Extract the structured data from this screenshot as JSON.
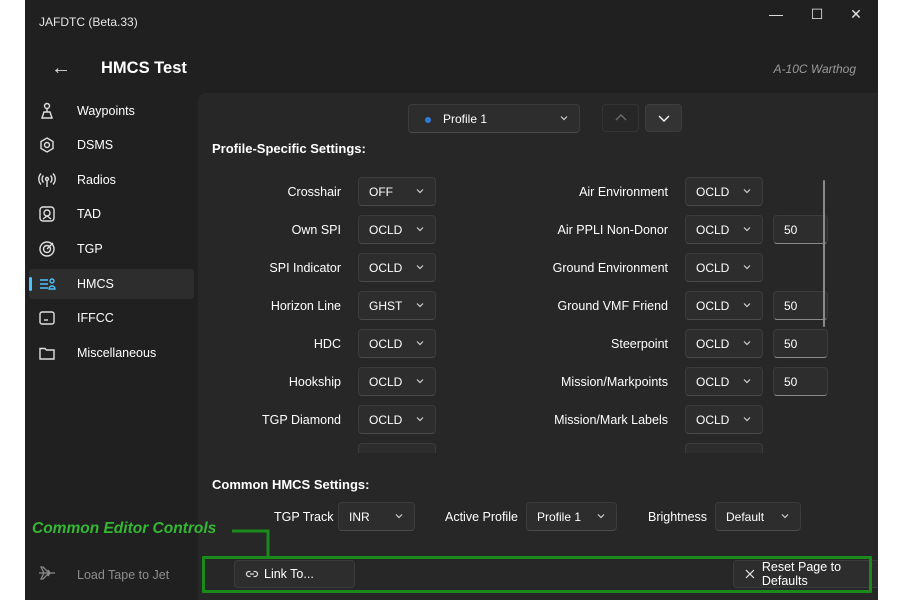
{
  "window": {
    "title": "JAFDTC (Beta.33)",
    "minimize_glyph": "—",
    "maximize_glyph": "☐",
    "close_glyph": "✕"
  },
  "header": {
    "back_glyph": "←",
    "title": "HMCS Test",
    "aircraft": "A-10C Warthog"
  },
  "sidebar": {
    "items": [
      {
        "label": "Waypoints",
        "icon": "waypoints-icon"
      },
      {
        "label": "DSMS",
        "icon": "dsms-icon"
      },
      {
        "label": "Radios",
        "icon": "radio-icon"
      },
      {
        "label": "TAD",
        "icon": "tad-icon"
      },
      {
        "label": "TGP",
        "icon": "tgp-icon"
      },
      {
        "label": "HMCS",
        "icon": "hmcs-icon",
        "selected": true
      },
      {
        "label": "IFFCC",
        "icon": "iffcc-icon"
      },
      {
        "label": "Miscellaneous",
        "icon": "folder-icon"
      }
    ],
    "load_tape": "Load Tape to Jet"
  },
  "profile_selector": {
    "value": "Profile 1",
    "accent": "#2e7cd6"
  },
  "profile_settings": {
    "heading": "Profile-Specific Settings:",
    "left": [
      {
        "label": "Crosshair",
        "value": "OFF"
      },
      {
        "label": "Own SPI",
        "value": "OCLD"
      },
      {
        "label": "SPI Indicator",
        "value": "OCLD"
      },
      {
        "label": "Horizon Line",
        "value": "GHST"
      },
      {
        "label": "HDC",
        "value": "OCLD"
      },
      {
        "label": "Hookship",
        "value": "OCLD"
      },
      {
        "label": "TGP Diamond",
        "value": "OCLD"
      }
    ],
    "right": [
      {
        "label": "Air Environment",
        "value": "OCLD",
        "number": ""
      },
      {
        "label": "Air PPLI Non-Donor",
        "value": "OCLD",
        "number": "50"
      },
      {
        "label": "Ground Environment",
        "value": "OCLD",
        "number": ""
      },
      {
        "label": "Ground VMF Friend",
        "value": "OCLD",
        "number": "50"
      },
      {
        "label": "Steerpoint",
        "value": "OCLD",
        "number": "50"
      },
      {
        "label": "Mission/Markpoints",
        "value": "OCLD",
        "number": "50"
      },
      {
        "label": "Mission/Mark Labels",
        "value": "OCLD",
        "number": ""
      }
    ]
  },
  "common_settings": {
    "heading": "Common HMCS Settings:",
    "tgp_track_label": "TGP Track",
    "tgp_track_value": "INR",
    "active_profile_label": "Active Profile",
    "active_profile_value": "Profile 1",
    "brightness_label": "Brightness",
    "brightness_value": "Default"
  },
  "editor_controls": {
    "link_label": "Link To...",
    "reset_label": "Reset Page to Defaults"
  },
  "annotation": {
    "label": "Common Editor Controls",
    "color": "#1a8a1a"
  }
}
